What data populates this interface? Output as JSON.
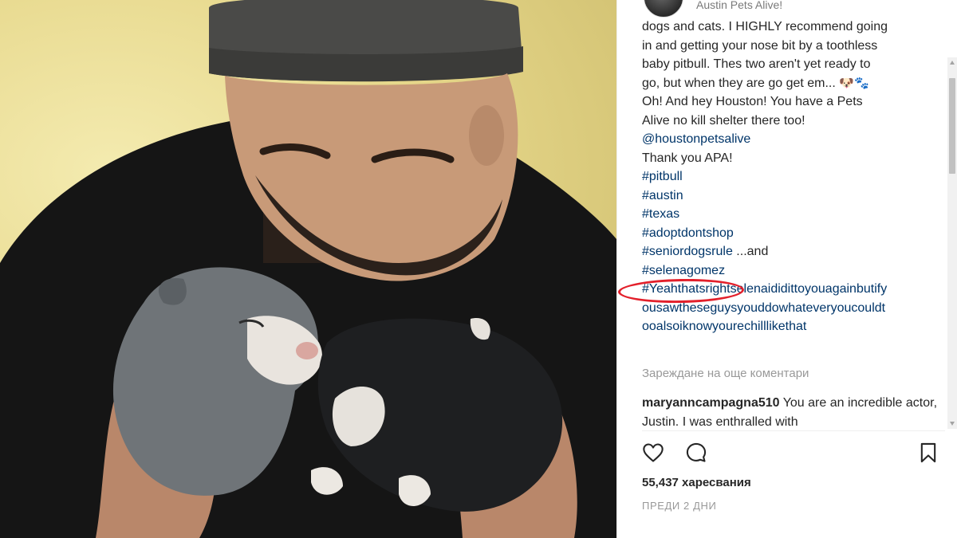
{
  "post": {
    "username": "Austin Pets Alive!",
    "caption_lines": [
      "dogs and cats. I HIGHLY recommend going",
      "in and getting your nose bit by a toothless",
      "baby pitbull. Thes two aren't yet ready to",
      "go, but when they are go get em...",
      "Oh! And hey Houston! You have a Pets",
      "Alive no kill shelter there too!"
    ],
    "caption_emoji": "🐶🐾",
    "mention": "@houstonpetsalive",
    "thanks": "Thank you APA!",
    "hashtags": [
      "#pitbull",
      "#austin",
      "#texas",
      "#adoptdontshop"
    ],
    "seniordogs_tag": "#seniordogsrule",
    "seniordogs_suffix": " ...and",
    "highlighted_tag": "#selenagomez",
    "long_tag_lines": [
      "#Yeahthatsrightselenaididittoyouagainbutify",
      "ousawtheseguysyouddowhateveryoucouldt",
      "ooalsoiknowyourechilllikethat"
    ],
    "load_more": "Зареждане на още коментари",
    "comment": {
      "author": "maryanncampagna510",
      "text": "You are an incredible actor, Justin. I was enthralled with"
    },
    "likes": "55,437 харесвания",
    "timestamp": "ПРЕДИ 2 ДНИ"
  },
  "icons": {
    "like": "heart-icon",
    "comment": "comment-bubble-icon",
    "save": "bookmark-icon"
  },
  "colors": {
    "hashtag": "#003569",
    "annotation_circle": "#e3202b",
    "muted_text": "#999999"
  }
}
